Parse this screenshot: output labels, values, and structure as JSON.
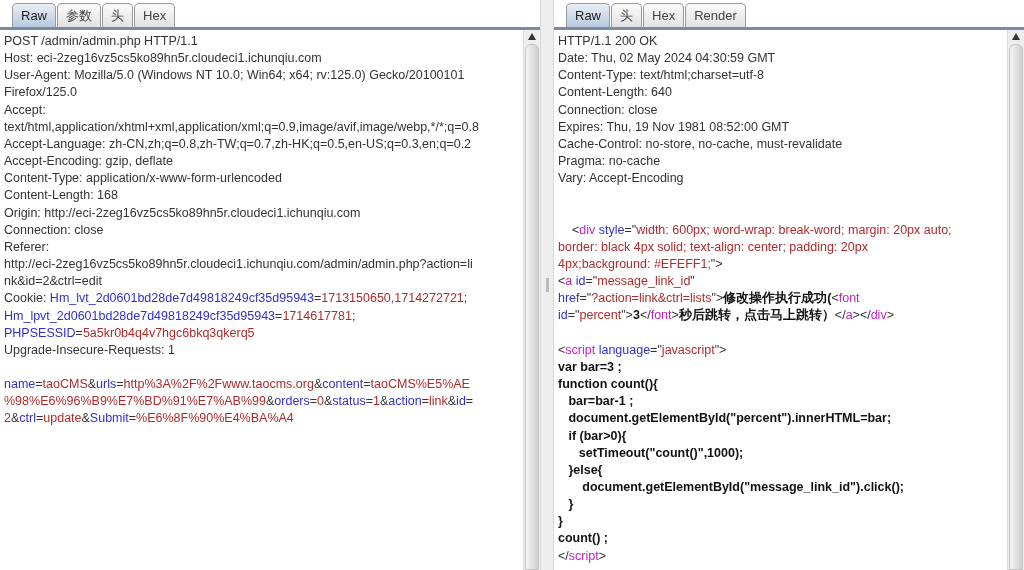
{
  "request": {
    "tabs": [
      {
        "label": "Raw",
        "selected": true
      },
      {
        "label": "参数",
        "selected": false
      },
      {
        "label": "头",
        "selected": false
      },
      {
        "label": "Hex",
        "selected": false
      }
    ],
    "lines": [
      {
        "kind": "text",
        "segments": [
          {
            "text": "POST /admin/admin.php HTTP/1.1",
            "kind": "plain"
          }
        ]
      },
      {
        "kind": "text",
        "segments": [
          {
            "text": "Host: eci-2zeg16vz5cs5ko89hn5r.cloudeci1.ichunqiu.com",
            "kind": "plain"
          }
        ]
      },
      {
        "kind": "text",
        "segments": [
          {
            "text": "User-Agent: Mozilla/5.0 (Windows NT 10.0; Win64; x64; rv:125.0) Gecko/20100101",
            "kind": "plain"
          }
        ]
      },
      {
        "kind": "text",
        "segments": [
          {
            "text": "Firefox/125.0",
            "kind": "plain"
          }
        ]
      },
      {
        "kind": "text",
        "segments": [
          {
            "text": "Accept:",
            "kind": "plain"
          }
        ]
      },
      {
        "kind": "text",
        "segments": [
          {
            "text": "text/html,application/xhtml+xml,application/xml;q=0.9,image/avif,image/webp,*/*;q=0.8",
            "kind": "plain"
          }
        ]
      },
      {
        "kind": "text",
        "segments": [
          {
            "text": "Accept-Language: zh-CN,zh;q=0.8,zh-TW;q=0.7,zh-HK;q=0.5,en-US;q=0.3,en;q=0.2",
            "kind": "plain"
          }
        ]
      },
      {
        "kind": "text",
        "segments": [
          {
            "text": "Accept-Encoding: gzip, deflate",
            "kind": "plain"
          }
        ]
      },
      {
        "kind": "text",
        "segments": [
          {
            "text": "Content-Type: application/x-www-form-urlencoded",
            "kind": "plain"
          }
        ]
      },
      {
        "kind": "text",
        "segments": [
          {
            "text": "Content-Length: 168",
            "kind": "plain"
          }
        ]
      },
      {
        "kind": "text",
        "segments": [
          {
            "text": "Origin: http://eci-2zeg16vz5cs5ko89hn5r.cloudeci1.ichunqiu.com",
            "kind": "plain"
          }
        ]
      },
      {
        "kind": "text",
        "segments": [
          {
            "text": "Connection: close",
            "kind": "plain"
          }
        ]
      },
      {
        "kind": "text",
        "segments": [
          {
            "text": "Referer:",
            "kind": "plain"
          }
        ]
      },
      {
        "kind": "text",
        "segments": [
          {
            "text": "http://eci-2zeg16vz5cs5ko89hn5r.cloudeci1.ichunqiu.com/admin/admin.php?action=li",
            "kind": "plain"
          }
        ]
      },
      {
        "kind": "text",
        "segments": [
          {
            "text": "nk&id=2&ctrl=edit",
            "kind": "plain"
          }
        ]
      },
      {
        "kind": "text",
        "segments": [
          {
            "text": "Cookie: ",
            "kind": "plain"
          },
          {
            "text": "Hm_lvt_2d0601bd28de7d49818249cf35d95943",
            "kind": "key"
          },
          {
            "text": "=",
            "kind": "plain"
          },
          {
            "text": "1713150650,1714272721",
            "kind": "value"
          },
          {
            "text": ";",
            "kind": "plain"
          }
        ]
      },
      {
        "kind": "text",
        "segments": [
          {
            "text": "Hm_lpvt_2d0601bd28de7d49818249cf35d95943",
            "kind": "key"
          },
          {
            "text": "=",
            "kind": "plain"
          },
          {
            "text": "1714617781",
            "kind": "value"
          },
          {
            "text": ";",
            "kind": "plain"
          }
        ]
      },
      {
        "kind": "text",
        "segments": [
          {
            "text": "PHPSESSID",
            "kind": "key"
          },
          {
            "text": "=",
            "kind": "plain"
          },
          {
            "text": "5a5kr0b4q4v7hgc6bkq3qkerq5",
            "kind": "value"
          }
        ]
      },
      {
        "kind": "text",
        "segments": [
          {
            "text": "Upgrade-Insecure-Requests: 1",
            "kind": "plain"
          }
        ]
      },
      {
        "kind": "blank"
      },
      {
        "kind": "text",
        "segments": [
          {
            "text": "name",
            "kind": "key"
          },
          {
            "text": "=",
            "kind": "plain"
          },
          {
            "text": "taoCMS",
            "kind": "value"
          },
          {
            "text": "&",
            "kind": "plain"
          },
          {
            "text": "urls",
            "kind": "key"
          },
          {
            "text": "=",
            "kind": "plain"
          },
          {
            "text": "http%3A%2F%2Fwww.taocms.org",
            "kind": "value"
          },
          {
            "text": "&",
            "kind": "plain"
          },
          {
            "text": "content",
            "kind": "key"
          },
          {
            "text": "=",
            "kind": "plain"
          },
          {
            "text": "taoCMS%E5%AE",
            "kind": "value"
          }
        ]
      },
      {
        "kind": "text",
        "segments": [
          {
            "text": "%98%E6%96%B9%E7%BD%91%E7%AB%99",
            "kind": "value"
          },
          {
            "text": "&",
            "kind": "plain"
          },
          {
            "text": "orders",
            "kind": "key"
          },
          {
            "text": "=",
            "kind": "plain"
          },
          {
            "text": "0",
            "kind": "value"
          },
          {
            "text": "&",
            "kind": "plain"
          },
          {
            "text": "status",
            "kind": "key"
          },
          {
            "text": "=",
            "kind": "plain"
          },
          {
            "text": "1",
            "kind": "value"
          },
          {
            "text": "&",
            "kind": "plain"
          },
          {
            "text": "action",
            "kind": "key"
          },
          {
            "text": "=",
            "kind": "plain"
          },
          {
            "text": "link",
            "kind": "value"
          },
          {
            "text": "&",
            "kind": "plain"
          },
          {
            "text": "id",
            "kind": "key"
          },
          {
            "text": "=",
            "kind": "plain"
          }
        ]
      },
      {
        "kind": "text",
        "segments": [
          {
            "text": "2",
            "kind": "value"
          },
          {
            "text": "&",
            "kind": "plain"
          },
          {
            "text": "ctrl",
            "kind": "key"
          },
          {
            "text": "=",
            "kind": "plain"
          },
          {
            "text": "update",
            "kind": "value"
          },
          {
            "text": "&",
            "kind": "plain"
          },
          {
            "text": "Submit",
            "kind": "key"
          },
          {
            "text": "=",
            "kind": "plain"
          },
          {
            "text": "%E6%8F%90%E4%BA%A4",
            "kind": "value"
          }
        ]
      }
    ]
  },
  "response": {
    "tabs": [
      {
        "label": "Raw",
        "selected": true
      },
      {
        "label": "头",
        "selected": false
      },
      {
        "label": "Hex",
        "selected": false
      },
      {
        "label": "Render",
        "selected": false
      }
    ],
    "lines": [
      {
        "kind": "text",
        "segments": [
          {
            "text": "HTTP/1.1 200 OK",
            "kind": "plain"
          }
        ]
      },
      {
        "kind": "text",
        "segments": [
          {
            "text": "Date: Thu, 02 May 2024 04:30:59 GMT",
            "kind": "plain"
          }
        ]
      },
      {
        "kind": "text",
        "segments": [
          {
            "text": "Content-Type: text/html;charset=utf-8",
            "kind": "plain"
          }
        ]
      },
      {
        "kind": "text",
        "segments": [
          {
            "text": "Content-Length: 640",
            "kind": "plain"
          }
        ]
      },
      {
        "kind": "text",
        "segments": [
          {
            "text": "Connection: close",
            "kind": "plain"
          }
        ]
      },
      {
        "kind": "text",
        "segments": [
          {
            "text": "Expires: Thu, 19 Nov 1981 08:52:00 GMT",
            "kind": "plain"
          }
        ]
      },
      {
        "kind": "text",
        "segments": [
          {
            "text": "Cache-Control: no-store, no-cache, must-revalidate",
            "kind": "plain"
          }
        ]
      },
      {
        "kind": "text",
        "segments": [
          {
            "text": "Pragma: no-cache",
            "kind": "plain"
          }
        ]
      },
      {
        "kind": "text",
        "segments": [
          {
            "text": "Vary: Accept-Encoding",
            "kind": "plain"
          }
        ]
      },
      {
        "kind": "blank"
      },
      {
        "kind": "blank"
      },
      {
        "kind": "text",
        "segments": [
          {
            "text": "    <",
            "kind": "plain"
          },
          {
            "text": "div",
            "kind": "tag"
          },
          {
            "text": " style",
            "kind": "key"
          },
          {
            "text": "=\"",
            "kind": "plain"
          },
          {
            "text": "width: 600px; word-wrap: break-word; margin: 20px auto;",
            "kind": "value"
          }
        ]
      },
      {
        "kind": "text",
        "segments": [
          {
            "text": "border: black 4px solid; text-align: center; padding: 20px",
            "kind": "value"
          }
        ]
      },
      {
        "kind": "text",
        "segments": [
          {
            "text": "4px;background: #EFEFF1;",
            "kind": "value"
          },
          {
            "text": "\">",
            "kind": "plain"
          }
        ]
      },
      {
        "kind": "text",
        "segments": [
          {
            "text": "<",
            "kind": "plain"
          },
          {
            "text": "a",
            "kind": "tag"
          },
          {
            "text": " id",
            "kind": "key"
          },
          {
            "text": "=\"",
            "kind": "plain"
          },
          {
            "text": "message_link_id",
            "kind": "value"
          },
          {
            "text": "\"",
            "kind": "plain"
          }
        ]
      },
      {
        "kind": "text",
        "segments": [
          {
            "text": "href",
            "kind": "key"
          },
          {
            "text": "=\"",
            "kind": "plain"
          },
          {
            "text": "?action=link&ctrl=lists",
            "kind": "value"
          },
          {
            "text": "\">",
            "kind": "plain"
          },
          {
            "text": "修改操作执行成功(",
            "kind": "bold"
          },
          {
            "text": "<",
            "kind": "plain"
          },
          {
            "text": "font",
            "kind": "tag"
          }
        ]
      },
      {
        "kind": "text",
        "segments": [
          {
            "text": "id",
            "kind": "key"
          },
          {
            "text": "=\"",
            "kind": "plain"
          },
          {
            "text": "percent",
            "kind": "value"
          },
          {
            "text": "\">",
            "kind": "plain"
          },
          {
            "text": "3",
            "kind": "bold"
          },
          {
            "text": "</",
            "kind": "plain"
          },
          {
            "text": "font",
            "kind": "tag"
          },
          {
            "text": ">",
            "kind": "plain"
          },
          {
            "text": "秒后跳转，点击马上跳转）",
            "kind": "bold"
          },
          {
            "text": "</",
            "kind": "plain"
          },
          {
            "text": "a",
            "kind": "tag"
          },
          {
            "text": "></",
            "kind": "plain"
          },
          {
            "text": "div",
            "kind": "tag"
          },
          {
            "text": ">",
            "kind": "plain"
          }
        ]
      },
      {
        "kind": "blank"
      },
      {
        "kind": "text",
        "segments": [
          {
            "text": "<",
            "kind": "plain"
          },
          {
            "text": "script",
            "kind": "tag"
          },
          {
            "text": " language",
            "kind": "key"
          },
          {
            "text": "=\"",
            "kind": "plain"
          },
          {
            "text": "javascript",
            "kind": "value"
          },
          {
            "text": "\">",
            "kind": "plain"
          }
        ]
      },
      {
        "kind": "text",
        "segments": [
          {
            "text": "var bar=3 ;",
            "kind": "bold"
          }
        ]
      },
      {
        "kind": "text",
        "segments": [
          {
            "text": "function count(){",
            "kind": "bold"
          }
        ]
      },
      {
        "kind": "text",
        "segments": [
          {
            "text": "   bar=bar-1 ;",
            "kind": "bold"
          }
        ]
      },
      {
        "kind": "text",
        "segments": [
          {
            "text": "   document.getElementById(\"percent\").innerHTML=bar;",
            "kind": "bold"
          }
        ]
      },
      {
        "kind": "text",
        "segments": [
          {
            "text": "   if (bar>0){",
            "kind": "bold"
          }
        ]
      },
      {
        "kind": "text",
        "segments": [
          {
            "text": "      setTimeout(\"count()\",1000);",
            "kind": "bold"
          }
        ]
      },
      {
        "kind": "text",
        "segments": [
          {
            "text": "   }else{",
            "kind": "bold"
          }
        ]
      },
      {
        "kind": "text",
        "segments": [
          {
            "text": "       document.getElementById(\"message_link_id\").click();",
            "kind": "bold"
          }
        ]
      },
      {
        "kind": "text",
        "segments": [
          {
            "text": "   }",
            "kind": "bold"
          }
        ]
      },
      {
        "kind": "text",
        "segments": [
          {
            "text": "}",
            "kind": "bold"
          }
        ]
      },
      {
        "kind": "text",
        "segments": [
          {
            "text": "count() ;",
            "kind": "bold"
          }
        ]
      },
      {
        "kind": "text",
        "segments": [
          {
            "text": "</",
            "kind": "plain"
          },
          {
            "text": "script",
            "kind": "tag"
          },
          {
            "text": ">",
            "kind": "plain"
          }
        ]
      }
    ]
  }
}
